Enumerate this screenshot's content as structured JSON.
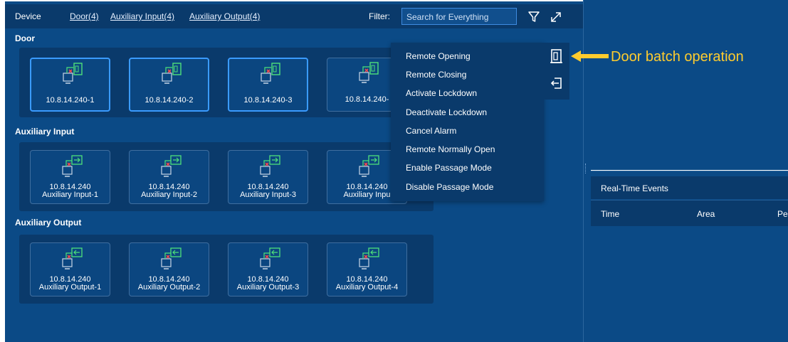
{
  "header": {
    "device_label": "Device",
    "tabs": [
      {
        "label": "Door(4)"
      },
      {
        "label": "Auxiliary Input(4)"
      },
      {
        "label": "Auxiliary Output(4)"
      }
    ],
    "filter_label": "Filter:",
    "search_placeholder": "Search for Everything",
    "icons": [
      "filter-icon",
      "collapse-icon"
    ]
  },
  "sections": {
    "door": {
      "title": "Door",
      "tiles": [
        {
          "line1": "10.8.14.240-1",
          "selected": true
        },
        {
          "line1": "10.8.14.240-2",
          "selected": true
        },
        {
          "line1": "10.8.14.240-3",
          "selected": true
        },
        {
          "line1": "10.8.14.240-",
          "selected": false
        }
      ]
    },
    "aux_input": {
      "title": "Auxiliary Input",
      "tiles": [
        {
          "line1": "10.8.14.240",
          "line2": "Auxiliary Input-1"
        },
        {
          "line1": "10.8.14.240",
          "line2": "Auxiliary Input-2"
        },
        {
          "line1": "10.8.14.240",
          "line2": "Auxiliary Input-3"
        },
        {
          "line1": "10.8.14.240",
          "line2": "Auxiliary Inpu"
        }
      ]
    },
    "aux_output": {
      "title": "Auxiliary Output",
      "tiles": [
        {
          "line1": "10.8.14.240",
          "line2": "Auxiliary Output-1"
        },
        {
          "line1": "10.8.14.240",
          "line2": "Auxiliary Output-2"
        },
        {
          "line1": "10.8.14.240",
          "line2": "Auxiliary Output-3"
        },
        {
          "line1": "10.8.14.240",
          "line2": "Auxiliary Output-4"
        }
      ]
    }
  },
  "context_menu": {
    "items": [
      "Remote Opening",
      "Remote Closing",
      "Activate Lockdown",
      "Deactivate Lockdown",
      "Cancel Alarm",
      "Remote Normally Open",
      "Enable Passage Mode",
      "Disable Passage Mode"
    ]
  },
  "batch_panel": {
    "icons": [
      "door-batch-icon",
      "door-exit-icon"
    ]
  },
  "annotation": {
    "text": "Door batch operation",
    "color": "#ffcc2e"
  },
  "real_time_events": {
    "title": "Real-Time Events",
    "columns": [
      "Time",
      "Area",
      "Per"
    ]
  },
  "colors": {
    "panel_bg": "#0b4a86",
    "header_bg": "#0a3a6b",
    "selected_border": "#3a9bff",
    "door_icon_green": "#4ee07a",
    "alarm_red": "#ff4b4b"
  }
}
